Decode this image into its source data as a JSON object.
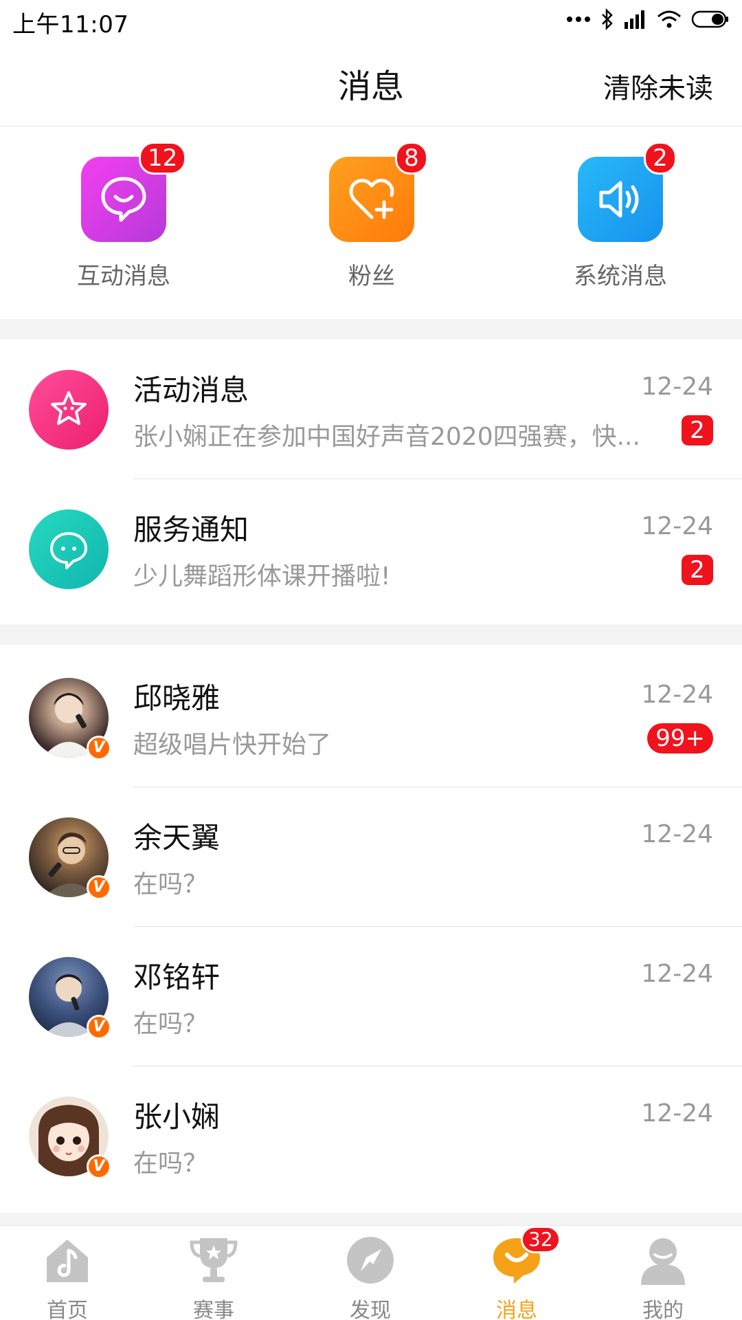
{
  "status_bar": {
    "time": "上午11:07"
  },
  "header": {
    "title": "消息",
    "clear_label": "清除未读"
  },
  "categories": [
    {
      "label": "互动消息",
      "badge": "12",
      "icon": "chat-smile-icon",
      "color_start": "#f33ff0",
      "color_end": "#b63ad8"
    },
    {
      "label": "粉丝",
      "badge": "8",
      "icon": "heart-plus-icon",
      "color_start": "#ffa01e",
      "color_end": "#ff7b0a"
    },
    {
      "label": "系统消息",
      "badge": "2",
      "icon": "speaker-icon",
      "color_start": "#28b8f8",
      "color_end": "#1692ee"
    }
  ],
  "notices": [
    {
      "name": "活动消息",
      "date": "12-24",
      "preview": "张小娴正在参加中国好声音2020四强赛，快...",
      "count": "2",
      "icon": "star-icon",
      "color": "#f3317e"
    },
    {
      "name": "服务通知",
      "date": "12-24",
      "preview": "少儿舞蹈形体课开播啦!",
      "count": "2",
      "icon": "chat-bubble-icon",
      "color": "#16c4b1"
    }
  ],
  "chats": [
    {
      "name": "邱晓雅",
      "date": "12-24",
      "preview": "超级唱片快开始了",
      "count": "99+",
      "avatar_color": "#3b2a2a",
      "verified": "V"
    },
    {
      "name": "余天翼",
      "date": "12-24",
      "preview": "在吗？",
      "count": "",
      "avatar_color": "#5a4a3e",
      "verified": "V"
    },
    {
      "name": "邓铭轩",
      "date": "12-24",
      "preview": "在吗？",
      "count": "",
      "avatar_color": "#33415e",
      "verified": "V"
    },
    {
      "name": "张小娴",
      "date": "12-24",
      "preview": "在吗？",
      "count": "",
      "avatar_color": "#c9a48a",
      "verified": "V"
    }
  ],
  "tabs": [
    {
      "label": "首页",
      "icon": "home-music-icon",
      "active": false
    },
    {
      "label": "赛事",
      "icon": "trophy-icon",
      "active": false
    },
    {
      "label": "发现",
      "icon": "compass-icon",
      "active": false
    },
    {
      "label": "消息",
      "icon": "message-icon",
      "active": true,
      "badge": "32"
    },
    {
      "label": "我的",
      "icon": "profile-icon",
      "active": false
    }
  ],
  "colors": {
    "accent": "#f5a218",
    "badge_red": "#f0121c",
    "verified_orange": "#ff6a00"
  }
}
